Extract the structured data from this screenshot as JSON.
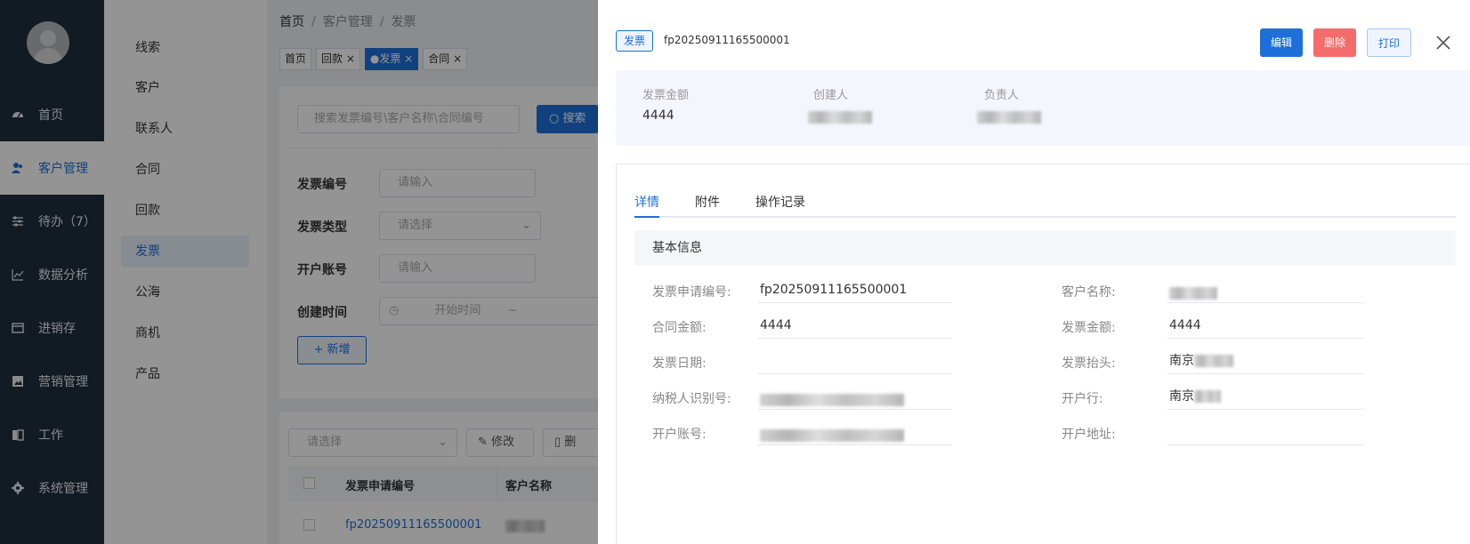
{
  "sidebar": {
    "items": [
      {
        "label": "首页",
        "icon": "dashboard-icon"
      },
      {
        "label": "客户管理",
        "icon": "user-group-icon"
      },
      {
        "label": "待办（7）",
        "icon": "sliders-icon"
      },
      {
        "label": "数据分析",
        "icon": "line-chart-icon"
      },
      {
        "label": "进销存",
        "icon": "box-icon"
      },
      {
        "label": "营销管理",
        "icon": "image-icon"
      },
      {
        "label": "工作",
        "icon": "book-icon"
      },
      {
        "label": "系统管理",
        "icon": "gear-icon"
      }
    ]
  },
  "submenu": {
    "items": [
      "线索",
      "客户",
      "联系人",
      "合同",
      "回款",
      "发票",
      "公海",
      "商机",
      "产品"
    ]
  },
  "breadcrumb": {
    "home": "首页",
    "parent": "客户管理",
    "current": "发票"
  },
  "tags": [
    {
      "label": "首页",
      "close": ""
    },
    {
      "label": "回款",
      "close": "×"
    },
    {
      "label": "●发票",
      "close": "×"
    },
    {
      "label": "合同",
      "close": "×"
    }
  ],
  "search": {
    "placeholder": "搜索发票编号\\客户名称\\合同编号",
    "button": "搜索"
  },
  "filters": {
    "invoice_no_label": "发票编号",
    "invoice_type_label": "发票类型",
    "account_label": "开户账号",
    "created_label": "创建时间",
    "input_placeholder": "请输入",
    "select_placeholder": "请选择",
    "start_time": "开始时间",
    "range_sep": "~",
    "add_button": "+ 新增"
  },
  "table_toolbar": {
    "select_placeholder": "请选择",
    "edit_button": "修改",
    "delete_button": "删"
  },
  "table": {
    "headers": [
      "发票申请编号",
      "客户名称"
    ],
    "rows": [
      {
        "number": "fp20250911165500001"
      }
    ]
  },
  "drawer": {
    "tag": "发票",
    "number": "fp20250911165500001",
    "buttons": {
      "edit": "编辑",
      "delete": "删除",
      "print": "打印"
    },
    "summary": {
      "amount_label": "发票金额",
      "amount": "4444",
      "creator_label": "创建人",
      "owner_label": "负责人"
    },
    "tabs": [
      "详情",
      "附件",
      "操作记录"
    ],
    "section_title": "基本信息",
    "fields": {
      "apply_no_label": "发票申请编号:",
      "apply_no": "fp20250911165500001",
      "customer_label": "客户名称:",
      "contract_amount_label": "合同金额:",
      "contract_amount": "4444",
      "invoice_amount_label": "发票金额:",
      "invoice_amount": "4444",
      "invoice_date_label": "发票日期:",
      "invoice_date": "",
      "invoice_title_label": "发票抬头:",
      "invoice_title": "南京",
      "taxpayer_label": "纳税人识别号:",
      "bank_label": "开户行:",
      "bank": "南京",
      "account_label": "开户账号:",
      "address_label": "开户地址:",
      "address": ""
    }
  },
  "colors": {
    "primary": "#1e6fd9",
    "danger": "#f56c6c",
    "sidebar": "#1f2d3d"
  }
}
